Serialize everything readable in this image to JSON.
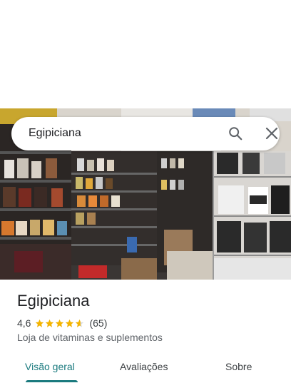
{
  "search": {
    "query": "Egipiciana",
    "search_icon": "search-icon",
    "close_icon": "close-icon"
  },
  "place": {
    "name": "Egipiciana",
    "rating": "4,6",
    "rating_value": 4.6,
    "rating_max": 5,
    "reviews": "(65)",
    "category": "Loja de vitaminas e suplementos",
    "star_color": "#F4B400"
  },
  "tabs": [
    {
      "label": "Visão geral",
      "active": true
    },
    {
      "label": "Avaliações",
      "active": false
    },
    {
      "label": "Sobre",
      "active": false
    }
  ],
  "accent_color": "#1A7A7E"
}
